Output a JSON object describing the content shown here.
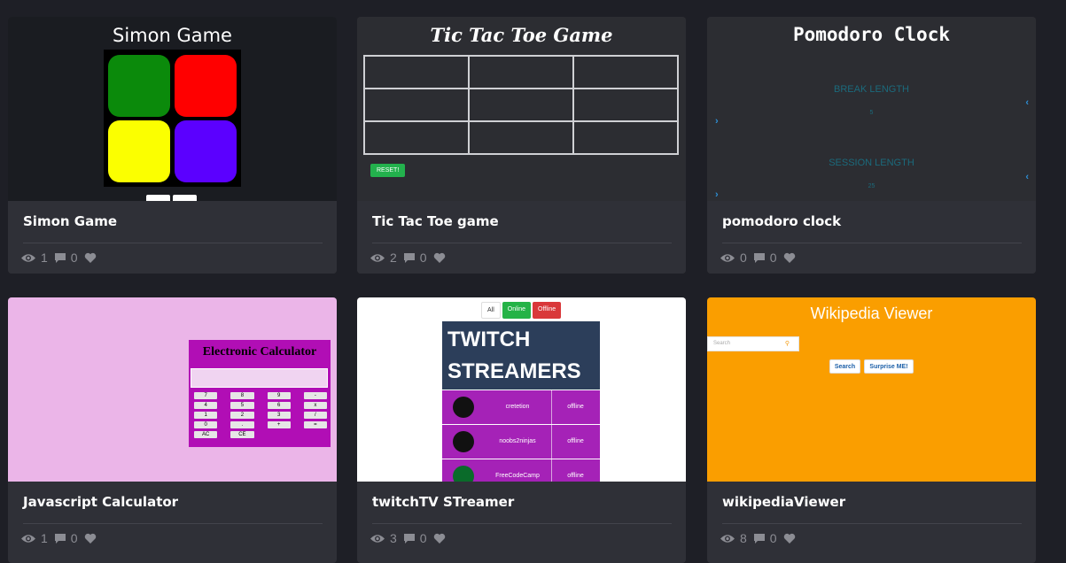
{
  "cards": [
    {
      "title": "Simon Game",
      "views": "1",
      "comments": "0",
      "preview": {
        "heading": "Simon Game",
        "colors": [
          "#0b8a0b",
          "#ff0000",
          "#fbff00",
          "#5b00ff"
        ]
      }
    },
    {
      "title": "Tic Tac Toe game",
      "views": "2",
      "comments": "0",
      "preview": {
        "heading": "Tic Tac Toe Game",
        "reset_label": "RESET!"
      }
    },
    {
      "title": "pomodoro clock",
      "views": "0",
      "comments": "0",
      "preview": {
        "heading": "Pomodoro Clock",
        "break_label": "BREAK LENGTH",
        "break_value": "5",
        "session_label": "SESSION LENGTH",
        "session_value": "25"
      }
    },
    {
      "title": "Javascript Calculator",
      "views": "1",
      "comments": "0",
      "preview": {
        "heading": "Electronic Calculator",
        "keys": [
          "7",
          "8",
          "9",
          "-",
          "4",
          "5",
          "6",
          "x",
          "1",
          "2",
          "3",
          "/",
          "0",
          ".",
          "+",
          "=",
          "AC",
          "CE"
        ]
      }
    },
    {
      "title": "twitchTV STreamer",
      "views": "3",
      "comments": "0",
      "preview": {
        "filters": {
          "all": "All",
          "online": "Online",
          "offline": "Offline"
        },
        "heading_line1": "TWITCH",
        "heading_line2": "STREAMERS",
        "streamers": [
          {
            "name": "cretetion",
            "status": "offline"
          },
          {
            "name": "noobs2ninjas",
            "status": "offline"
          },
          {
            "name": "FreeCodeCamp",
            "status": "offline"
          }
        ]
      }
    },
    {
      "title": "wikipediaViewer",
      "views": "8",
      "comments": "0",
      "preview": {
        "heading": "Wikipedia Viewer",
        "search_placeholder": "Search",
        "search_button": "Search",
        "surprise_button": "Surprise ME!"
      }
    }
  ],
  "colors": {
    "background": "#1e1f26",
    "card": "#2f3037",
    "stat_text": "#8c8d94",
    "calc_bg": "#ebb5e8",
    "wiki_bg": "#fa9e00",
    "twitch_row": "#a522b7"
  }
}
